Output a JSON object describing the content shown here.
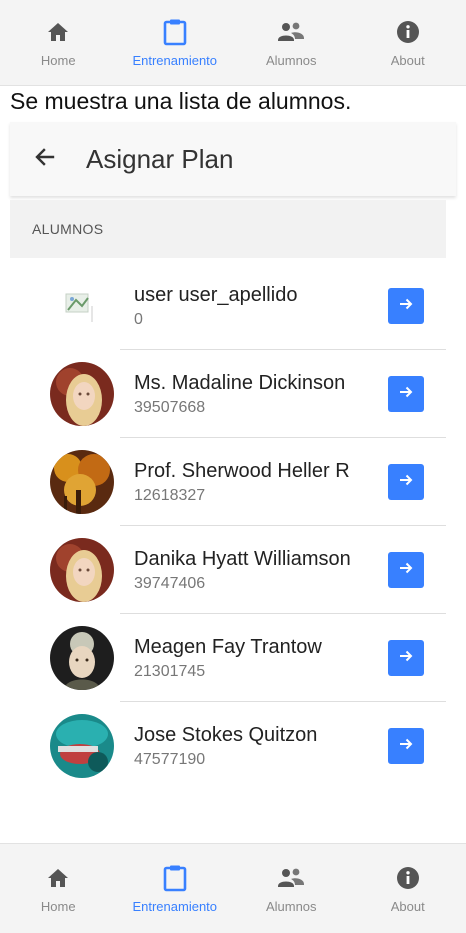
{
  "tabs": [
    {
      "label": "Home",
      "icon": "home-icon",
      "active": false
    },
    {
      "label": "Entrenamiento",
      "icon": "clipboard-icon",
      "active": true
    },
    {
      "label": "Alumnos",
      "icon": "people-icon",
      "active": false
    },
    {
      "label": "About",
      "icon": "info-icon",
      "active": false
    }
  ],
  "caption": "Se muestra una lista de alumnos.",
  "header": {
    "title": "Asignar Plan",
    "back_icon": "arrow-back-icon"
  },
  "list": {
    "header": "ALUMNOS",
    "items": [
      {
        "name": "user user_apellido",
        "doc": "0",
        "avatar": "broken-image"
      },
      {
        "name": "Ms. Madaline Dickinson",
        "doc": "39507668",
        "avatar": "blonde-woman-photo"
      },
      {
        "name": "Prof. Sherwood Heller R",
        "doc": "12618327",
        "avatar": "autumn-tree-photo"
      },
      {
        "name": "Danika Hyatt Williamson",
        "doc": "39747406",
        "avatar": "blonde-woman-photo"
      },
      {
        "name": "Meagen Fay Trantow",
        "doc": "21301745",
        "avatar": "woman-portrait-photo"
      },
      {
        "name": "Jose Stokes Quitzon",
        "doc": "47577190",
        "avatar": "surgeon-photo"
      }
    ]
  },
  "colors": {
    "accent": "#3880ff",
    "inactive": "#8a8a8a"
  }
}
